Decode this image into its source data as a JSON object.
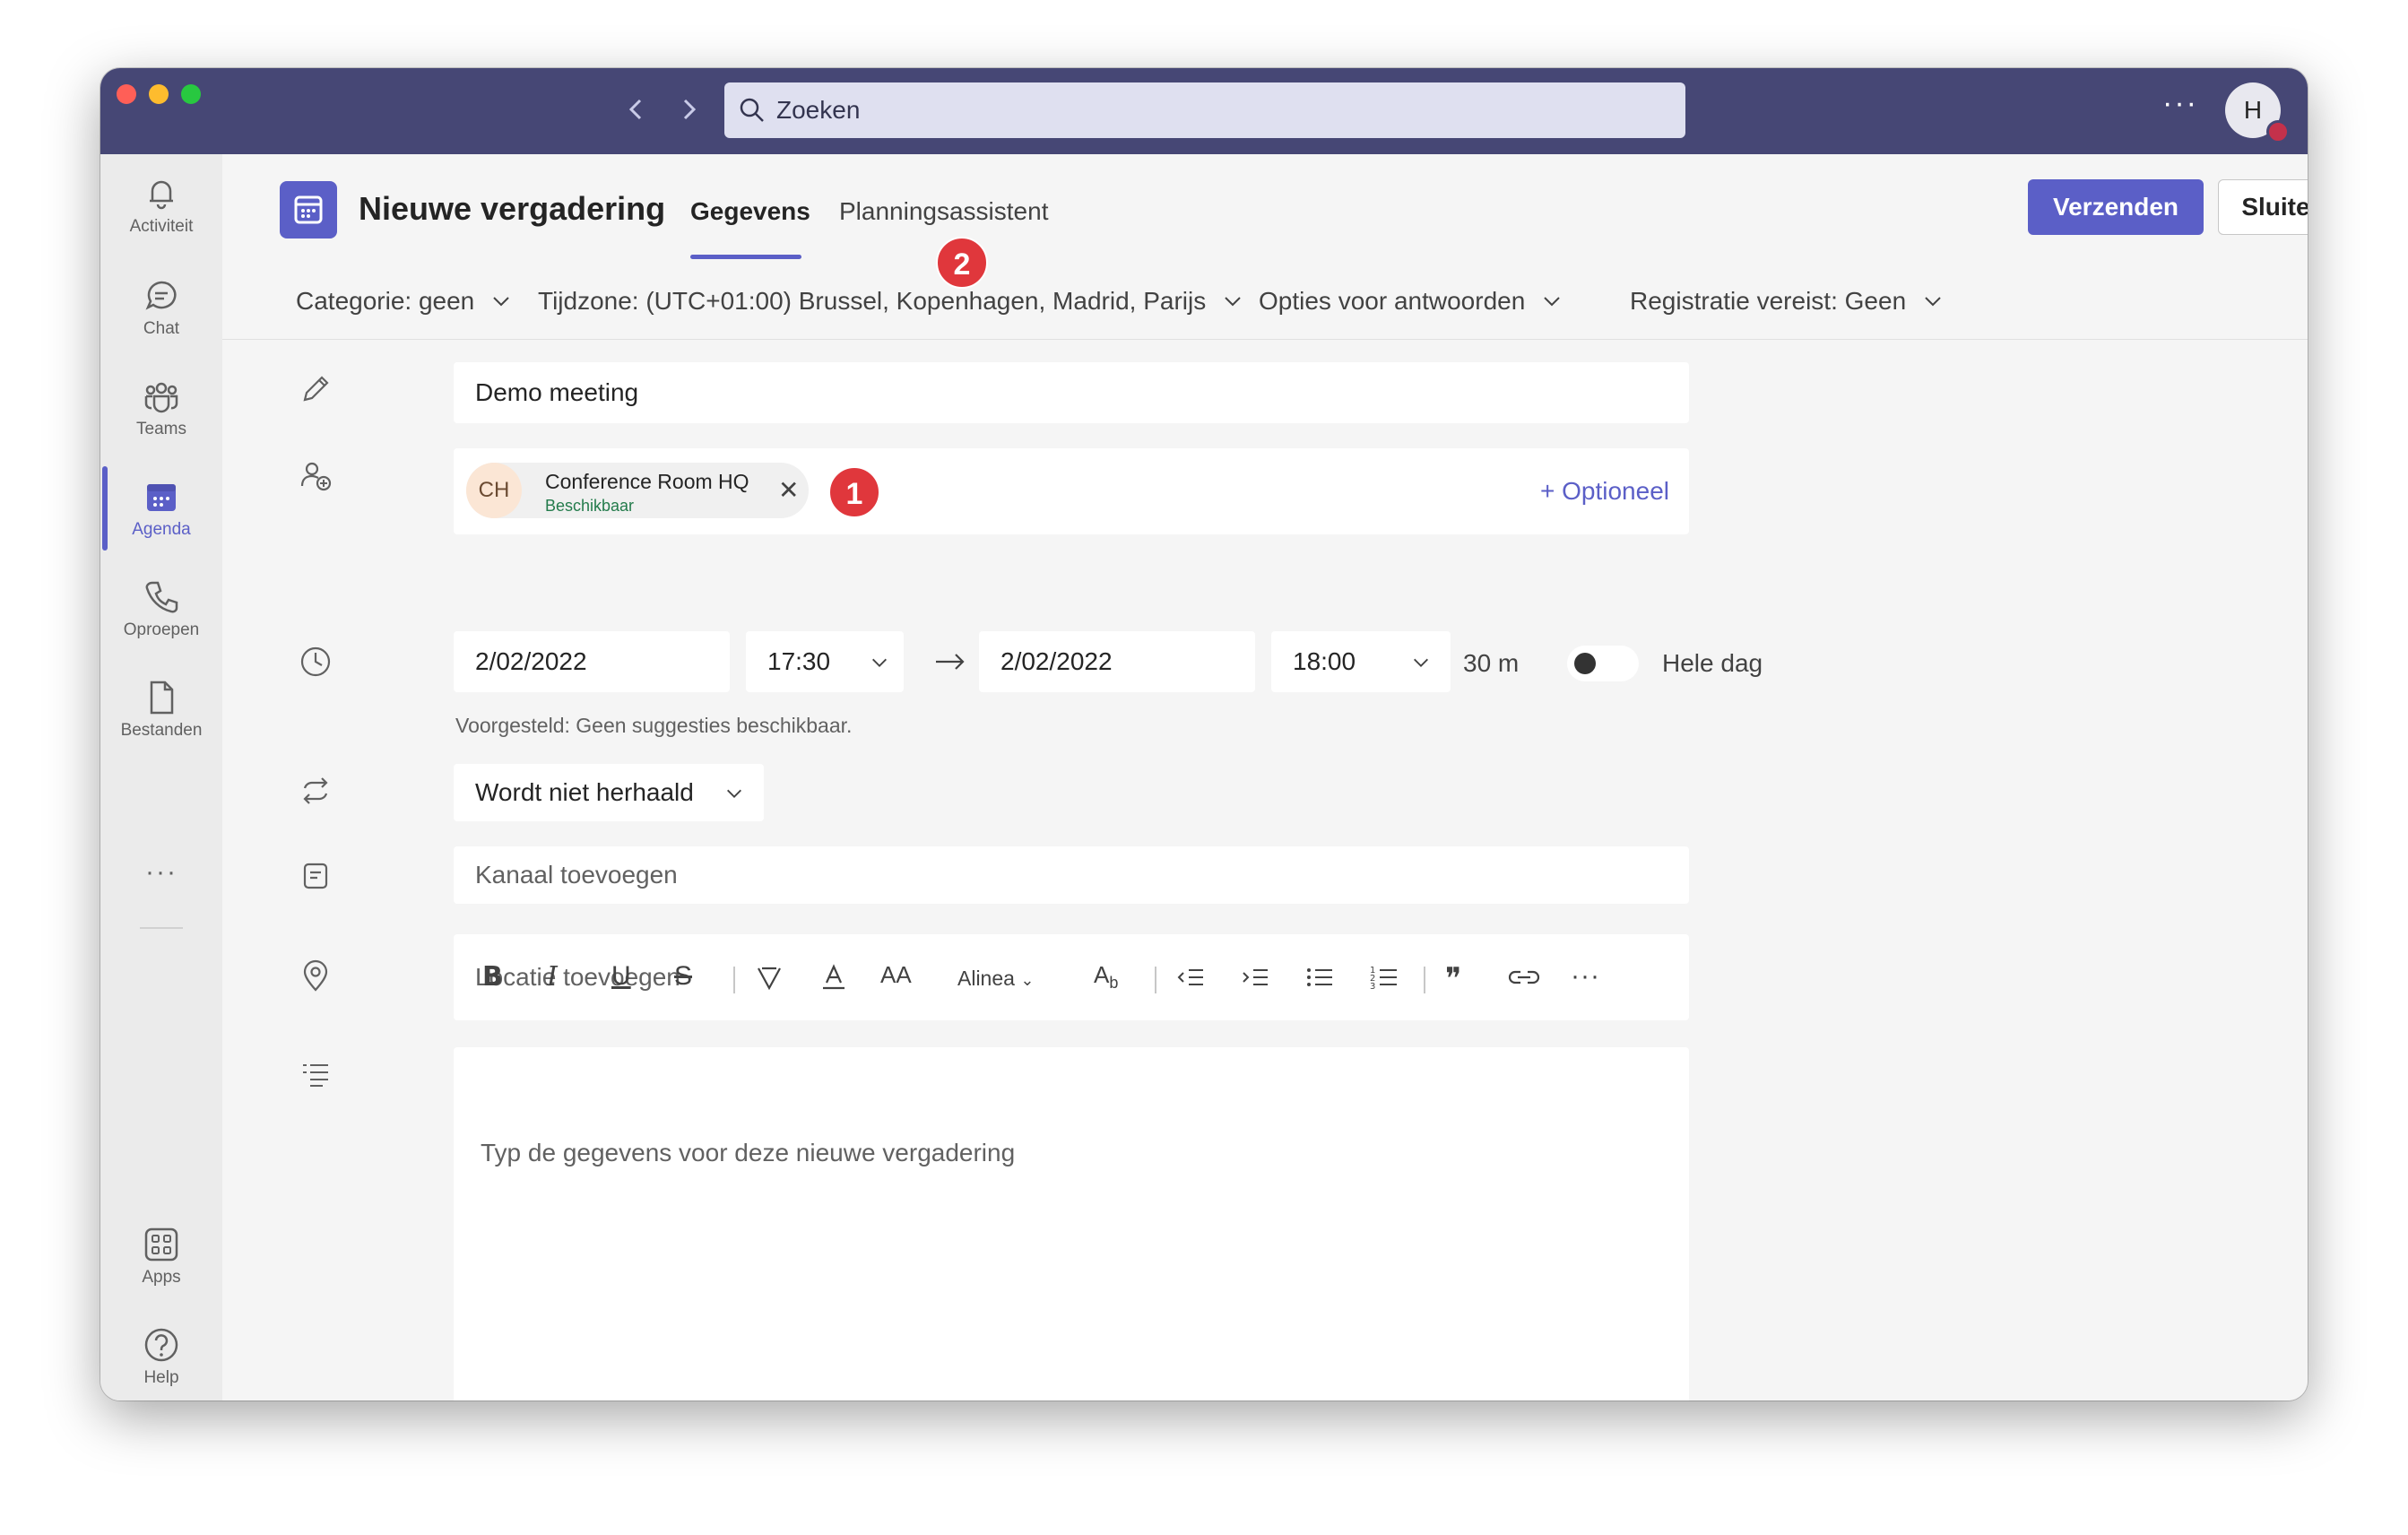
{
  "titlebar": {
    "search_placeholder": "Zoeken",
    "avatar_initial": "H",
    "more": "···"
  },
  "rail": {
    "items": [
      {
        "label": "Activiteit",
        "icon": "bell-icon"
      },
      {
        "label": "Chat",
        "icon": "chat-icon"
      },
      {
        "label": "Teams",
        "icon": "teams-icon"
      },
      {
        "label": "Agenda",
        "icon": "calendar-icon",
        "active": true
      },
      {
        "label": "Oproepen",
        "icon": "phone-icon"
      },
      {
        "label": "Bestanden",
        "icon": "file-icon"
      }
    ],
    "more": "···",
    "bottom": [
      {
        "label": "Apps",
        "icon": "apps-icon"
      },
      {
        "label": "Help",
        "icon": "help-icon"
      }
    ]
  },
  "header": {
    "title": "Nieuwe vergadering",
    "tabs": [
      "Gegevens",
      "Planningsassistent"
    ],
    "send": "Verzenden",
    "close": "Sluiten"
  },
  "options": {
    "category": "Categorie: geen",
    "timezone": "Tijdzone: (UTC+01:00) Brussel, Kopenhagen, Madrid, Parijs",
    "response": "Opties voor antwoorden",
    "registration": "Registratie vereist: Geen"
  },
  "form": {
    "title_value": "Demo meeting",
    "attendee": {
      "initials": "CH",
      "name": "Conference Room HQ",
      "status": "Beschikbaar"
    },
    "optional": "+ Optioneel",
    "start_date": "2/02/2022",
    "start_time": "17:30",
    "end_date": "2/02/2022",
    "end_time": "18:00",
    "duration": "30 m",
    "all_day": "Hele dag",
    "all_day_on": false,
    "suggestion": "Voorgesteld: Geen suggesties beschikbaar.",
    "repeat": "Wordt niet herhaald",
    "channel_placeholder": "Kanaal toevoegen",
    "location_placeholder": "Locatie toevoegen",
    "details_placeholder": "Typ de gegevens voor deze nieuwe vergadering"
  },
  "editor": {
    "paragraph": "Alinea",
    "more": "···"
  },
  "badges": {
    "one": "1",
    "two": "2"
  },
  "colors": {
    "titlebar": "#464775",
    "accent": "#5b5fc7",
    "badge": "#e0373c",
    "available": "#237b4b"
  }
}
